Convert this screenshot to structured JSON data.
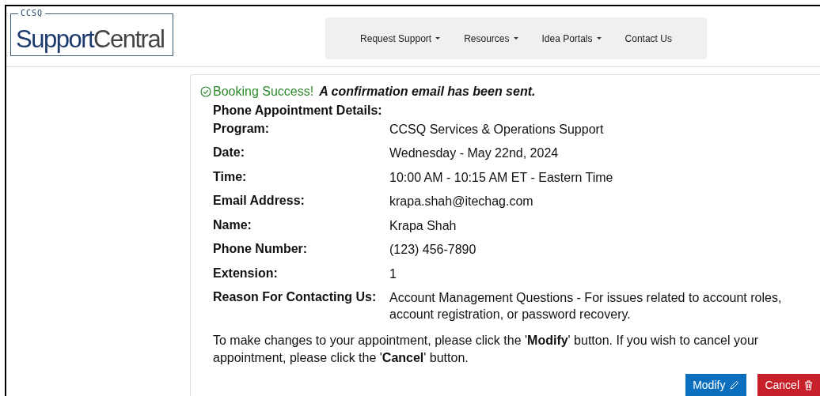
{
  "logo": {
    "tag": "CCSQ",
    "name_1": "Support",
    "name_2": "Central"
  },
  "nav": [
    {
      "label": "Request Support",
      "dropdown": true
    },
    {
      "label": "Resources",
      "dropdown": true
    },
    {
      "label": "Idea Portals",
      "dropdown": true
    },
    {
      "label": "Contact Us",
      "dropdown": false
    }
  ],
  "confirmation": {
    "title": "Booking Success!",
    "message": "A confirmation email has been sent.",
    "heading": "Phone Appointment Details:",
    "details": [
      {
        "label": "Program:",
        "value": "CCSQ Services & Operations Support"
      },
      {
        "label": "Date:",
        "value": "Wednesday - May 22nd, 2024"
      },
      {
        "label": "Time:",
        "value": "10:00 AM - 10:15 AM ET - Eastern Time"
      },
      {
        "label": "Email Address:",
        "value": "krapa.shah@itechag.com"
      },
      {
        "label": "Name:",
        "value": "Krapa Shah"
      },
      {
        "label": "Phone Number:",
        "value": "(123) 456-7890"
      },
      {
        "label": "Extension:",
        "value": "1"
      },
      {
        "label": "Reason For Contacting Us:",
        "value": "Account Management Questions - For issues related to account roles, account registration, or password recovery."
      }
    ],
    "note": "To make changes to your appointment, please click the '**Modify**' button. If you wish to cancel your appointment, please click the '**Cancel**' button.",
    "buttons": [
      {
        "label": "Modify",
        "kind": "primary"
      },
      {
        "label": "Cancel",
        "kind": "danger"
      }
    ]
  }
}
